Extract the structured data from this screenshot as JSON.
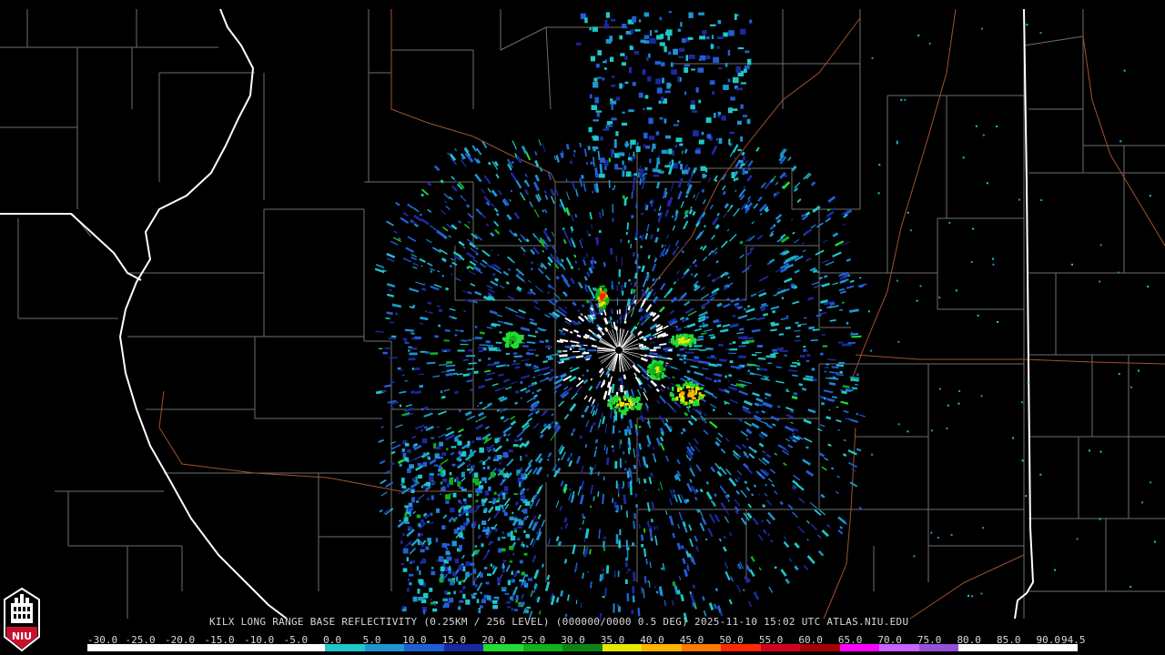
{
  "caption": "KILX LONG RANGE BASE REFLECTIVITY (0.25KM / 256 LEVEL) (000000/0000 0.5 DEG) 2025-11-10 15:02 UTC  ATLAS.NIU.EDU",
  "legend": {
    "ticks": [
      "-30.0",
      "-25.0",
      "-20.0",
      "-15.0",
      "-10.0",
      "-5.0",
      "0.0",
      "5.0",
      "10.0",
      "15.0",
      "20.0",
      "25.0",
      "30.0",
      "35.0",
      "40.0",
      "45.0",
      "50.0",
      "55.0",
      "60.0",
      "65.0",
      "70.0",
      "75.0",
      "80.0",
      "85.0",
      "90.0",
      "94.5"
    ],
    "colors": [
      "#ffffff",
      "#ffffff",
      "#ffffff",
      "#ffffff",
      "#ffffff",
      "#ffffff",
      "#1fc8c8",
      "#1e96d2",
      "#1f5fd6",
      "#1c28a0",
      "#22dc36",
      "#11b21c",
      "#0c8414",
      "#e8e800",
      "#ffb400",
      "#ff7800",
      "#ff2800",
      "#d2001e",
      "#a50000",
      "#ff00ff",
      "#c864ff",
      "#9650dc",
      "#ffffff",
      "#ffffff",
      "#ffffff"
    ]
  },
  "colors": {
    "background": "#000000",
    "county_lines": "#6e6e6e",
    "state_lines": "#ffffff",
    "highways": "#a0522d",
    "logo_red": "#c8102e"
  },
  "logo": {
    "text": "NIU"
  }
}
